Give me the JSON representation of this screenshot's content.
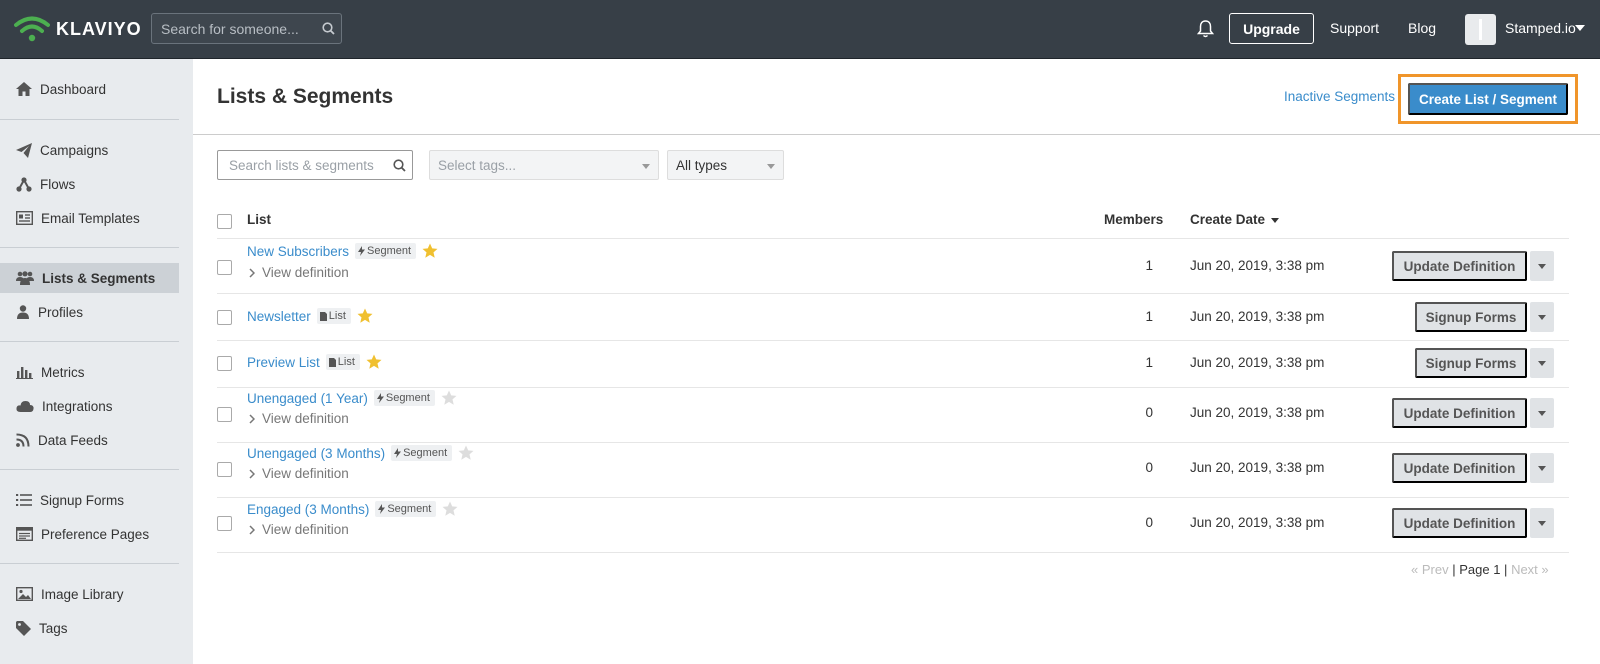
{
  "topbar": {
    "brand": "KLAVIYO",
    "search_placeholder": "Search for someone...",
    "upgrade": "Upgrade",
    "support": "Support",
    "blog": "Blog",
    "account": "Stamped.io"
  },
  "sidebar": {
    "items": [
      {
        "label": "Dashboard",
        "icon": "home-icon"
      },
      {
        "label": "Campaigns",
        "icon": "paper-plane-icon"
      },
      {
        "label": "Flows",
        "icon": "flow-icon"
      },
      {
        "label": "Email Templates",
        "icon": "template-icon"
      },
      {
        "label": "Lists & Segments",
        "icon": "users-icon",
        "active": true
      },
      {
        "label": "Profiles",
        "icon": "user-icon"
      },
      {
        "label": "Metrics",
        "icon": "bar-chart-icon"
      },
      {
        "label": "Integrations",
        "icon": "cloud-icon"
      },
      {
        "label": "Data Feeds",
        "icon": "rss-icon"
      },
      {
        "label": "Signup Forms",
        "icon": "form-list-icon"
      },
      {
        "label": "Preference Pages",
        "icon": "browser-window-icon"
      },
      {
        "label": "Image Library",
        "icon": "image-icon"
      },
      {
        "label": "Tags",
        "icon": "tag-icon"
      }
    ]
  },
  "main": {
    "title": "Lists & Segments",
    "inactive_link": "Inactive Segments",
    "create_button": "Create List / Segment",
    "filters": {
      "search_placeholder": "Search lists & segments",
      "tags_placeholder": "Select tags...",
      "type_value": "All types"
    },
    "table": {
      "headers": {
        "list": "List",
        "members": "Members",
        "create_date": "Create Date"
      },
      "rows": [
        {
          "name": "New Subscribers",
          "type": "Segment",
          "starred": true,
          "view_def": "View definition",
          "members": "1",
          "date": "Jun 20, 2019, 3:38 pm",
          "action": "Update Definition"
        },
        {
          "name": "Newsletter",
          "type": "List",
          "starred": true,
          "view_def": "",
          "members": "1",
          "date": "Jun 20, 2019, 3:38 pm",
          "action": "Signup Forms"
        },
        {
          "name": "Preview List",
          "type": "List",
          "starred": true,
          "view_def": "",
          "members": "1",
          "date": "Jun 20, 2019, 3:38 pm",
          "action": "Signup Forms"
        },
        {
          "name": "Unengaged (1 Year)",
          "type": "Segment",
          "starred": false,
          "view_def": "View definition",
          "members": "0",
          "date": "Jun 20, 2019, 3:38 pm",
          "action": "Update Definition"
        },
        {
          "name": "Unengaged (3 Months)",
          "type": "Segment",
          "starred": false,
          "view_def": "View definition",
          "members": "0",
          "date": "Jun 20, 2019, 3:38 pm",
          "action": "Update Definition"
        },
        {
          "name": "Engaged (3 Months)",
          "type": "Segment",
          "starred": false,
          "view_def": "View definition",
          "members": "0",
          "date": "Jun 20, 2019, 3:38 pm",
          "action": "Update Definition"
        }
      ]
    },
    "pager": {
      "prev": "« Prev",
      "sep": "|",
      "page": "Page 1",
      "next": "Next »"
    }
  },
  "colors": {
    "topbar": "#373f47",
    "accent": "#3a8ccb",
    "highlight": "#f0952a",
    "star": "#f0c030",
    "star_off": "#dddddd"
  }
}
